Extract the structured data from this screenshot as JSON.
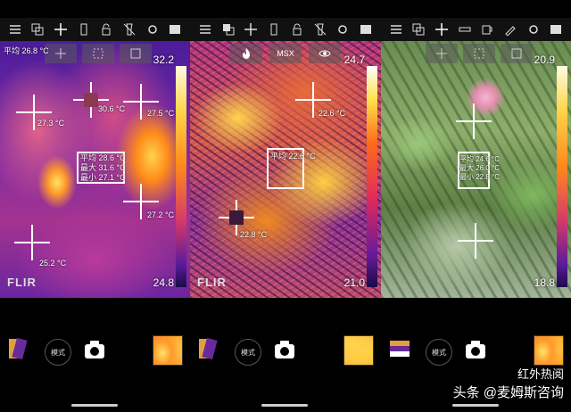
{
  "panels": [
    {
      "id": "iron-thermal",
      "avg_top": "平均 26.8 °C",
      "scale_max": "32.2",
      "scale_min": "24.8",
      "brand": "FLIR",
      "spots": [
        "27.3 °C",
        "30.6 °C",
        "27.5 °C",
        "27.2 °C",
        "25.2 °C"
      ],
      "box_stats": [
        "平均 28.6 °C",
        "最大 31.6 °C",
        "最小 27.1 °C"
      ],
      "mode_label": "模式"
    },
    {
      "id": "msx-thermal",
      "mode_tabs": [
        "MSX"
      ],
      "scale_max": "24.7",
      "scale_min": "21.0",
      "brand": "FLIR",
      "spots": [
        "22.6 °C",
        "22.8 °C"
      ],
      "box_avg": "平均 22.6 °C",
      "mode_label": "模式"
    },
    {
      "id": "visual",
      "scale_max": "20.9",
      "scale_min": "18.8",
      "box_stats": [
        "平均 24.6 °C",
        "最大 26.0 °C",
        "最小 22.8 °C"
      ],
      "mode_label": "模式"
    }
  ],
  "watermark": {
    "line1": "红外热阅",
    "source": "头条",
    "handle": "@麦姆斯咨询"
  },
  "colors": {
    "accent": "#2a7bff",
    "toolbar": "#111111"
  }
}
